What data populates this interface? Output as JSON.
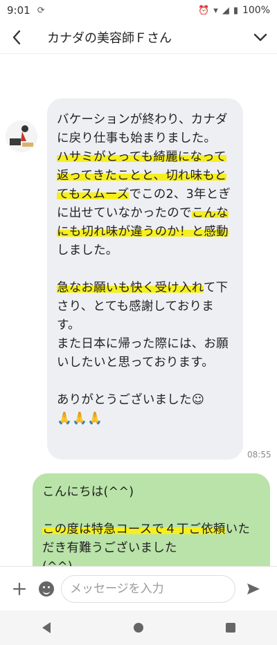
{
  "status_bar": {
    "time": "9:01",
    "battery": "100%"
  },
  "header": {
    "title": "カナダの美容師Ｆさん"
  },
  "incoming": {
    "segments": [
      {
        "text": "バケーションが終わり、カナダに戻り仕事も始まりました。\n",
        "hl": false
      },
      {
        "text": "ハサミがとっても綺麗になって返ってきたことと、切れ味もとてもスムーズ",
        "hl": true
      },
      {
        "text": "でこの2、3年とぎに出せていなかったので",
        "hl": false
      },
      {
        "text": "こんなにも切れ味が違うのか！と感動",
        "hl": true
      },
      {
        "text": "しました。\n\n",
        "hl": false
      },
      {
        "text": "急なお願いも快く受け入れ",
        "hl": true
      },
      {
        "text": "て下さり、とても感謝しております。\nまた日本に帰った際には、お願いしたいと思っております。\n\nありがとうございました☺\n🙏🙏🙏",
        "hl": false
      }
    ],
    "time": "08:55"
  },
  "outgoing": {
    "segments": [
      {
        "text": "こんにちは(^^)\n\n",
        "hl": false
      },
      {
        "text": "この度は特急コースで４丁ご依頼",
        "hl": true
      },
      {
        "text": "いただき有難うございました\n(^^)\n\nスムーズな切れ味でご満足いただけたようですね！\nそれはそれは良かったです",
        "hl": false
      }
    ]
  },
  "input": {
    "placeholder": "メッセージを入力"
  }
}
